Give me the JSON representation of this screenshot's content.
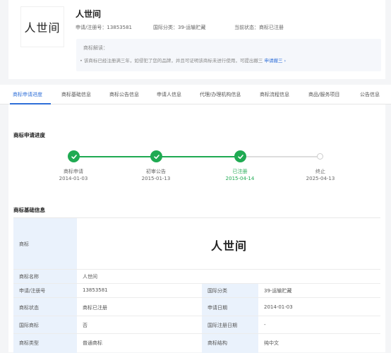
{
  "header": {
    "logo_text": "人世间",
    "title": "人世间",
    "reg_no_label": "申请/注册号：",
    "reg_no": "13853581",
    "intl_class_label": "国际分类：",
    "intl_class": "39-运输贮藏",
    "status_label": "当前状态：",
    "status": "商标已注册",
    "notice_title": "商标解读：",
    "notice_body": "• 该商标已经注册满三年，如侵犯了您的品牌，并且可证明该商标未进行使用，可提出撤三",
    "notice_link": "申请撤三 ›"
  },
  "tabs": [
    "商标申请进度",
    "商标基础信息",
    "商标公告信息",
    "申请人信息",
    "代理/办理机构信息",
    "商标流程信息",
    "商品/服务项目",
    "公告信息"
  ],
  "progress": {
    "title": "商标申请进度",
    "steps": [
      {
        "label": "商标申请",
        "date": "2014-01-03",
        "done": true
      },
      {
        "label": "初审公告",
        "date": "2015-01-13",
        "done": true
      },
      {
        "label": "已注册",
        "date": "2015-04-14",
        "done": true
      },
      {
        "label": "终止",
        "date": "2025-04-13",
        "done": false
      }
    ]
  },
  "basic": {
    "title": "商标基础信息",
    "mark_label": "商标",
    "mark_text": "人世间",
    "rows": [
      {
        "l1": "商标名称",
        "v1": "人世间",
        "l2": "",
        "v2": ""
      },
      {
        "l1": "申请/注册号",
        "v1": "13853581",
        "l2": "国际分类",
        "v2": "39-运输贮藏"
      },
      {
        "l1": "商标状态",
        "v1": "商标已注册",
        "l2": "申请日期",
        "v2": "2014-01-03"
      },
      {
        "l1": "国际商标",
        "v1": "否",
        "l2": "国际注册日期",
        "v2": "-"
      },
      {
        "l1": "商标类型",
        "v1": "普通商标",
        "l2": "商标结构",
        "v2": "纯中文"
      }
    ]
  },
  "colors": {
    "accent": "#2f6fd8",
    "success": "#1faa52",
    "label_bg": "#eaf2fc"
  }
}
